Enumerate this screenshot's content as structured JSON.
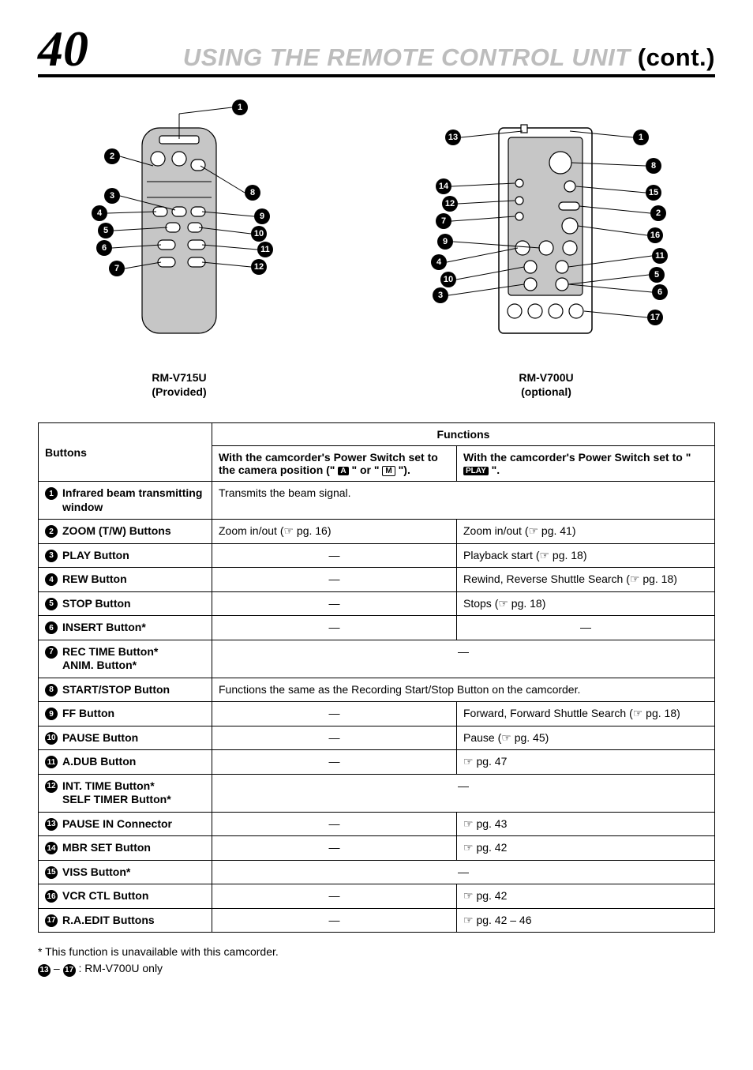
{
  "header": {
    "page_number": "40",
    "title_main": "USING THE REMOTE CONTROL UNIT",
    "title_cont": "(cont.)"
  },
  "diagrams": {
    "left": {
      "model": "RM-V715U",
      "note": "(Provided)"
    },
    "right": {
      "model": "RM-V700U",
      "note": "(optional)"
    }
  },
  "table": {
    "col_buttons": "Buttons",
    "col_functions": "Functions",
    "col_cam_prefix": "With the camcorder's Power Switch set to the camera position (\" ",
    "col_cam_mid": " \" or \" ",
    "col_cam_suffix": " \").",
    "col_play_prefix": "With the camcorder's Power Switch set to \" ",
    "col_play_suffix": " \".",
    "box_A": "A",
    "box_M": "M",
    "box_PLAY": "PLAY",
    "rows": [
      {
        "num": "1",
        "label": "Infrared beam transmitting window",
        "cam": "Transmits the beam signal.",
        "play": null,
        "span": true
      },
      {
        "num": "2",
        "label": "ZOOM (T/W) Buttons",
        "cam": "Zoom in/out (☞ pg. 16)",
        "play": "Zoom in/out (☞ pg. 41)"
      },
      {
        "num": "3",
        "label": "PLAY Button",
        "cam": "—",
        "play": "Playback start (☞ pg. 18)"
      },
      {
        "num": "4",
        "label": "REW Button",
        "cam": "—",
        "play": "Rewind, Reverse Shuttle Search (☞ pg. 18)"
      },
      {
        "num": "5",
        "label": "STOP Button",
        "cam": "—",
        "play": "Stops (☞ pg. 18)"
      },
      {
        "num": "6",
        "label": "INSERT Button*",
        "cam": "—",
        "play": "—"
      },
      {
        "num": "7",
        "label": "REC TIME Button*\nANIM. Button*",
        "cam": "—",
        "play": null,
        "span": true,
        "center": true
      },
      {
        "num": "8",
        "label": "START/STOP Button",
        "cam": "Functions the same as the Recording Start/Stop Button on the camcorder.",
        "play": null,
        "span": true
      },
      {
        "num": "9",
        "label": "FF Button",
        "cam": "—",
        "play": "Forward, Forward Shuttle Search (☞ pg. 18)"
      },
      {
        "num": "10",
        "label": "PAUSE Button",
        "cam": "—",
        "play": "Pause (☞ pg. 45)"
      },
      {
        "num": "11",
        "label": "A.DUB Button",
        "cam": "—",
        "play": "☞ pg. 47"
      },
      {
        "num": "12",
        "label": "INT. TIME Button*\nSELF TIMER Button*",
        "cam": "—",
        "play": null,
        "span": true,
        "center": true
      },
      {
        "num": "13",
        "label": "PAUSE IN Connector",
        "cam": "—",
        "play": "☞ pg. 43"
      },
      {
        "num": "14",
        "label": "MBR SET Button",
        "cam": "—",
        "play": "☞ pg. 42"
      },
      {
        "num": "15",
        "label": "VISS Button*",
        "cam": "—",
        "play": null,
        "span": true,
        "center": true
      },
      {
        "num": "16",
        "label": "VCR CTL Button",
        "cam": "—",
        "play": "☞ pg. 42"
      },
      {
        "num": "17",
        "label": "R.A.EDIT Buttons",
        "cam": "—",
        "play": "☞ pg. 42 – 46"
      }
    ]
  },
  "footnotes": {
    "asterisk": "* This function is unavailable with this camcorder.",
    "range_from": "13",
    "range_to": "17",
    "range_text": " : RM-V700U only"
  }
}
